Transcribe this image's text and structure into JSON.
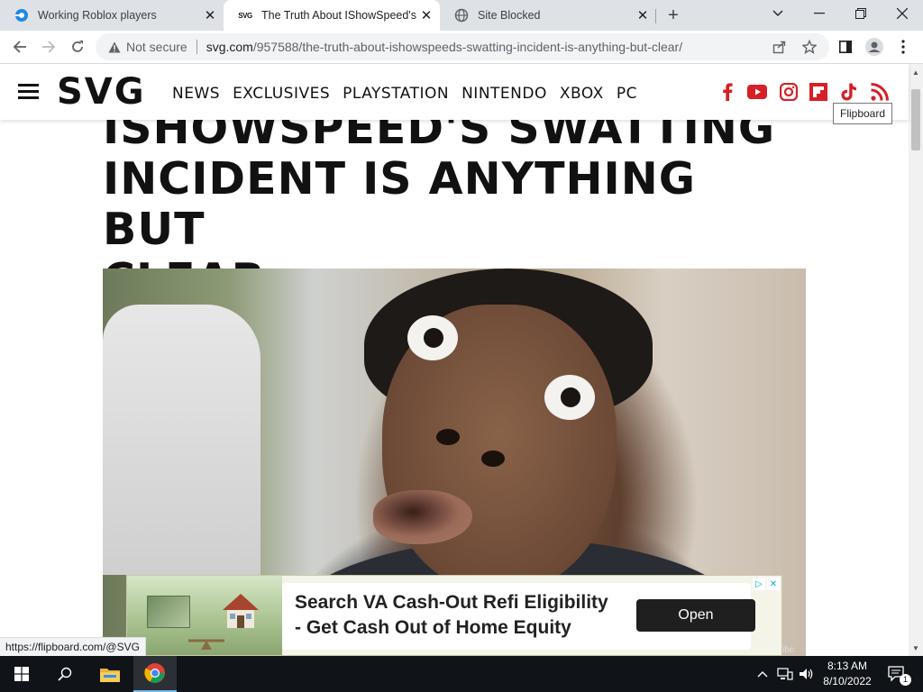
{
  "browser": {
    "tabs": [
      {
        "title": "Working Roblox players",
        "favicon": "roblox-studio-icon"
      },
      {
        "title": "The Truth About IShowSpeed's Sw",
        "favicon": "svg-favicon",
        "favicon_text": "SVG"
      },
      {
        "title": "Site Blocked",
        "favicon": "globe-icon"
      }
    ],
    "address": {
      "security_label": "Not secure",
      "host": "svg.com",
      "path": "/957588/the-truth-about-ishowspeeds-swatting-incident-is-anything-but-clear/"
    },
    "status_url": "https://flipboard.com/@SVG"
  },
  "site": {
    "logo": "SVG",
    "nav": [
      "NEWS",
      "EXCLUSIVES",
      "PLAYSTATION",
      "NINTENDO",
      "XBOX",
      "PC"
    ],
    "social_icons": [
      "facebook-icon",
      "youtube-icon",
      "instagram-icon",
      "flipboard-icon",
      "tiktok-icon",
      "rss-icon"
    ],
    "accent_color": "#d61f26",
    "tooltip": "Flipboard"
  },
  "article": {
    "headline_lines": [
      "ISHOWSPEED'S SWATTING",
      "INCIDENT IS ANYTHING BUT",
      "CLEAR"
    ],
    "image_credit": "ibe"
  },
  "ad": {
    "line1": "Search VA Cash-Out Refi Eligibility",
    "line2": "- Get Cash Out of Home Equity",
    "button": "Open"
  },
  "taskbar": {
    "time": "8:13 AM",
    "date": "8/10/2022",
    "notification_count": "1"
  }
}
